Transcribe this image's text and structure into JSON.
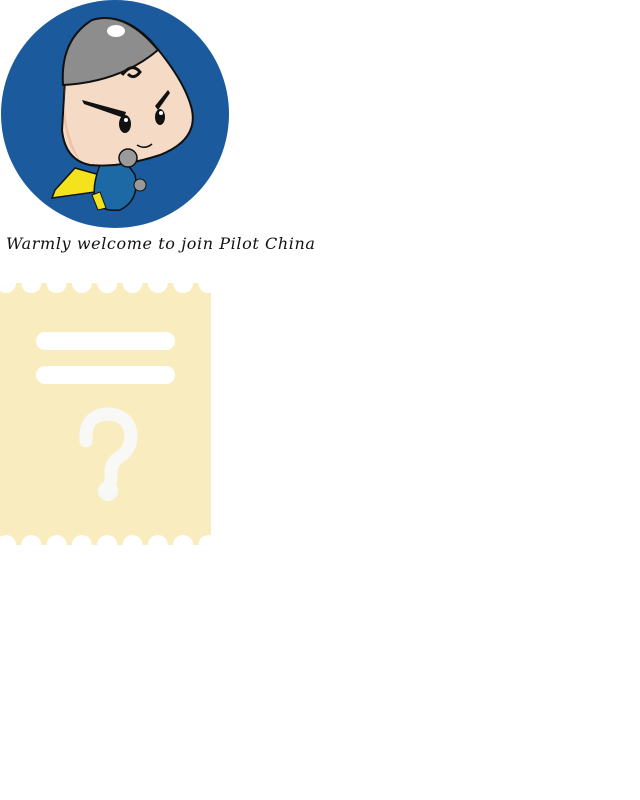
{
  "welcome_text": "Warmly welcome to join Pilot China",
  "colors": {
    "circle": "#1b5a9d",
    "ticket": "#f9edbf",
    "question": "#f8f8f6"
  },
  "icons": [
    "mascot-illustration",
    "empty-ticket-icon",
    "question-mark-icon"
  ]
}
